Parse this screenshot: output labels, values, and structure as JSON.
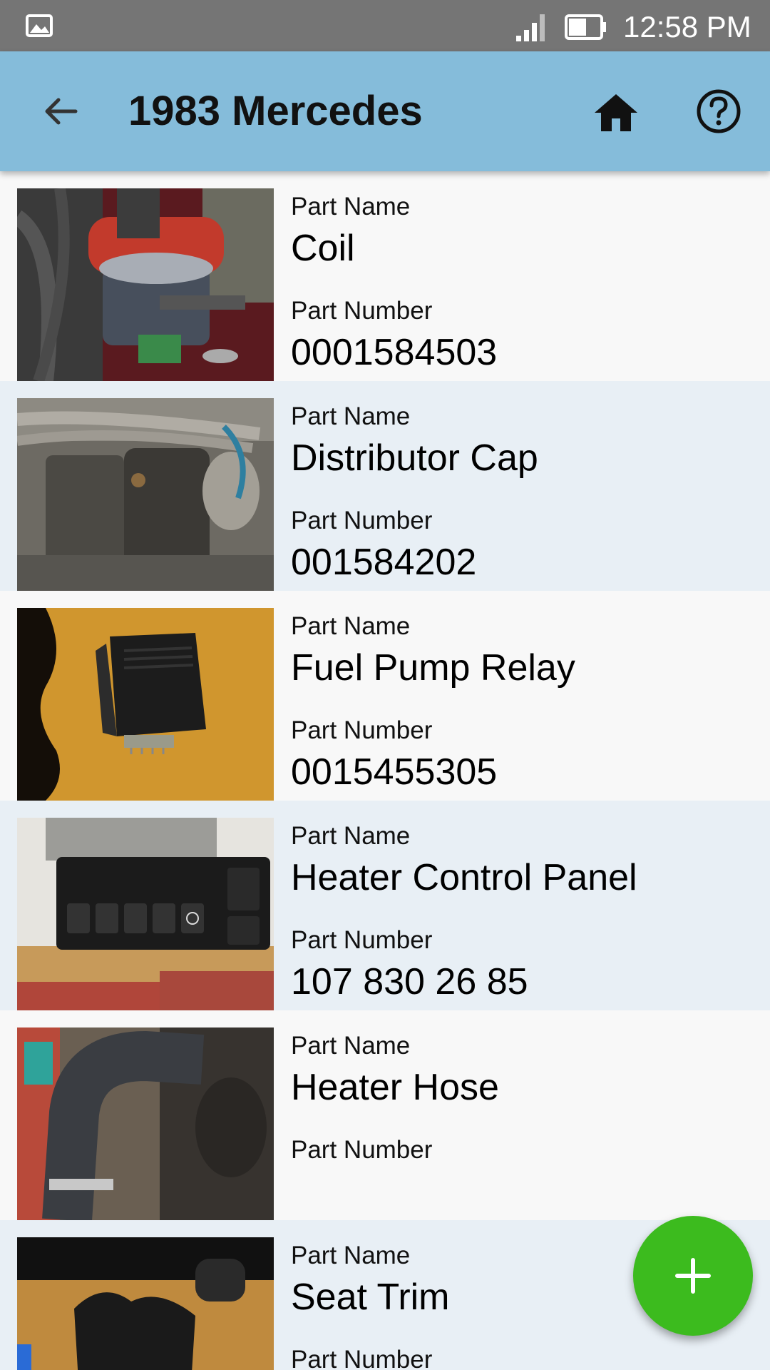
{
  "status_bar": {
    "time": "12:58 PM",
    "icons": [
      "gallery-icon",
      "signal-icon",
      "battery-icon"
    ]
  },
  "app_bar": {
    "title": "1983 Mercedes",
    "back_icon": "arrow-back-icon",
    "home_icon": "home-icon",
    "help_icon": "help-circle-icon",
    "background": "#85bcda"
  },
  "parts_list": {
    "name_label": "Part Name",
    "number_label": "Part Number",
    "items": [
      {
        "name": "Coil",
        "number": "0001584503"
      },
      {
        "name": "Distributor Cap",
        "number": "001584202"
      },
      {
        "name": "Fuel Pump Relay",
        "number": "0015455305"
      },
      {
        "name": "Heater Control Panel",
        "number": "107 830 26 85"
      },
      {
        "name": "Heater Hose",
        "number": ""
      },
      {
        "name": "Seat Trim",
        "number": ""
      }
    ]
  },
  "fab": {
    "icon": "plus-icon",
    "color": "#3cbb1e"
  }
}
